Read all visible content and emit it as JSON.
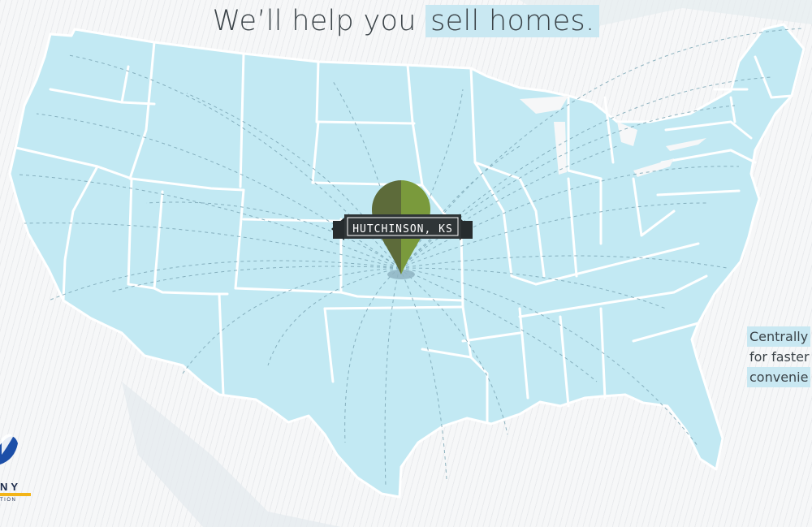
{
  "headline": {
    "lead": "We’ll help you ",
    "highlight": "sell homes."
  },
  "marker": {
    "location": "HUTCHINSON, KS",
    "colors": {
      "left": "#5d6b3a",
      "right": "#7a9a3c",
      "banner": "#2f3537"
    }
  },
  "side_text": {
    "line1": "Centrally",
    "line2": "for faster",
    "line3": "convenie"
  },
  "logo": {
    "word": "NY",
    "sub": "TION",
    "icon": "swoosh-logo-icon",
    "colors": {
      "primary": "#1c4fa8",
      "accent": "#f3b418"
    }
  },
  "colors": {
    "land": "#c2e9f3",
    "state_borders": "#ffffff",
    "routes": "#7ba6b5",
    "highlight": "#c9e8f2",
    "text": "#3b4348"
  }
}
